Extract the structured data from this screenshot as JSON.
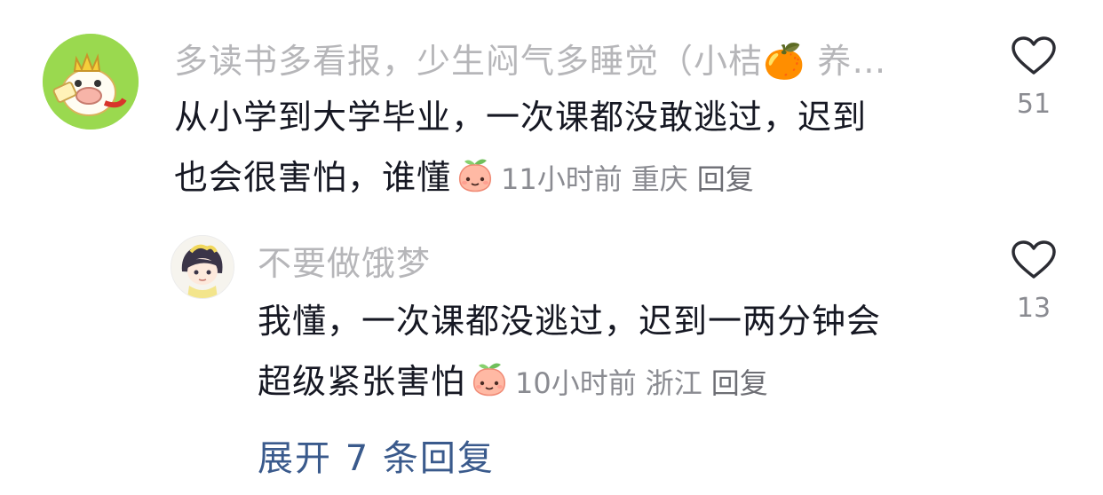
{
  "comments": [
    {
      "username": "多读书多看报，少生闷气多睡觉（小桔🍊 养…",
      "line1": "从小学到大学毕业，一次课都没敢逃过，迟到",
      "line2": "也会很害怕，谁懂",
      "time": "11小时前",
      "location": "重庆",
      "reply_label": "回复",
      "likes": "51",
      "avatar_icon": "cartoon-pig-crown-avatar",
      "emoji_icon": "peach-smile-emoji"
    },
    {
      "username": "不要做饿梦",
      "line1": "我懂，一次课都没逃过，迟到一两分钟会",
      "line2": "超级紧张害怕",
      "time": "10小时前",
      "location": "浙江",
      "reply_label": "回复",
      "likes": "13",
      "avatar_icon": "anime-girl-avatar",
      "emoji_icon": "peach-smile-emoji"
    }
  ],
  "expand_replies": "展开 7 条回复",
  "colors": {
    "accent_link": "#3a5a8c",
    "muted": "#8a8b91",
    "username": "#b6b6b9"
  }
}
